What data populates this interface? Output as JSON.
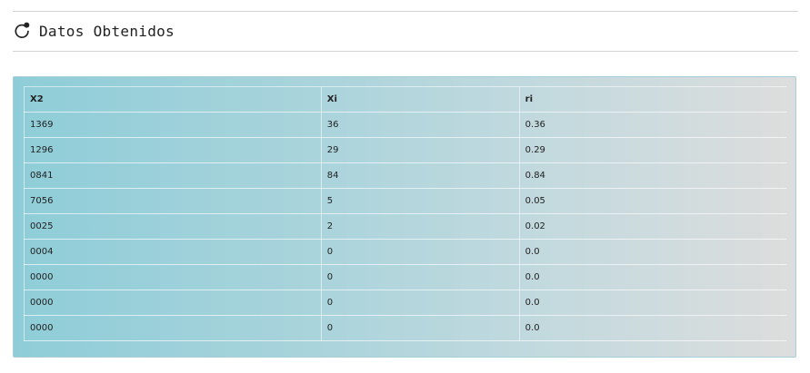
{
  "header": {
    "title": "Datos Obtenidos",
    "icon": "refresh-icon"
  },
  "table": {
    "columns": [
      "X2",
      "Xi",
      "ri"
    ],
    "rows": [
      [
        "1369",
        "36",
        "0.36"
      ],
      [
        "1296",
        "29",
        "0.29"
      ],
      [
        "0841",
        "84",
        "0.84"
      ],
      [
        "7056",
        "5",
        "0.05"
      ],
      [
        "0025",
        "2",
        "0.02"
      ],
      [
        "0004",
        "0",
        "0.0"
      ],
      [
        "0000",
        "0",
        "0.0"
      ],
      [
        "0000",
        "0",
        "0.0"
      ],
      [
        "0000",
        "0",
        "0.0"
      ]
    ]
  },
  "colors": {
    "panel_gradient_start": "#8ecdd8",
    "panel_gradient_end": "#dddddd",
    "divider": "#d4d4d4"
  }
}
